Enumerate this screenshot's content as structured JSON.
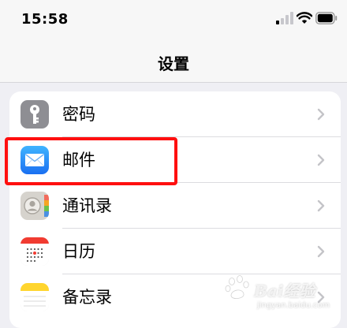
{
  "status_bar": {
    "time": "15:58",
    "icons": [
      "cellular-signal-icon",
      "wifi-icon",
      "battery-icon"
    ]
  },
  "nav": {
    "title": "设置"
  },
  "settings_list": {
    "items": [
      {
        "label": "密码",
        "icon": "key-icon",
        "icon_color": "#8e8e93"
      },
      {
        "label": "邮件",
        "icon": "mail-icon",
        "icon_color": "#1e7cf5"
      },
      {
        "label": "通讯录",
        "icon": "contacts-icon",
        "icon_color": "#d1cec8"
      },
      {
        "label": "日历",
        "icon": "calendar-icon",
        "icon_color": "#ffffff"
      },
      {
        "label": "备忘录",
        "icon": "notes-icon",
        "icon_color": "#ffd52e"
      }
    ]
  },
  "annotation": {
    "highlight_color": "#ff0f0f"
  },
  "watermark": {
    "brand": "Bai经验",
    "url": "jingyan.baidu.com"
  }
}
